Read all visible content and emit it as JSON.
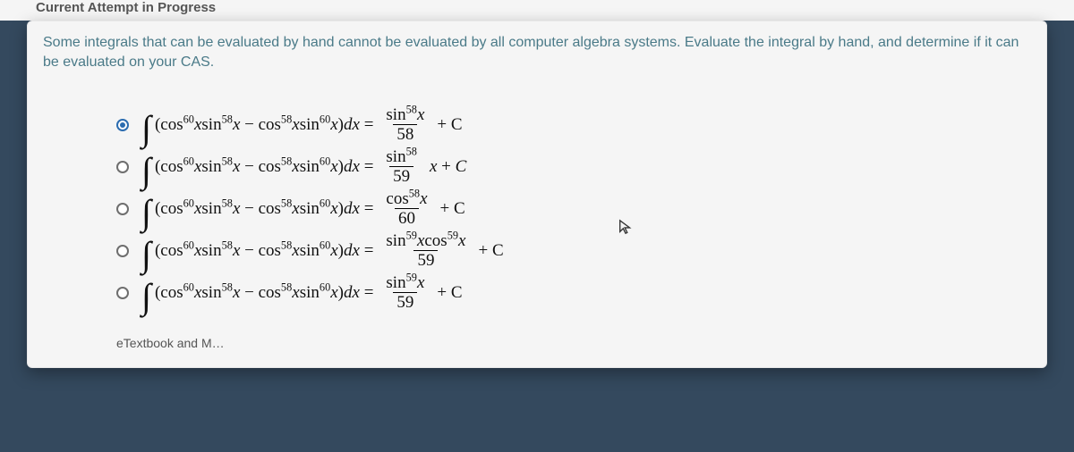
{
  "header": {
    "title": "Current Attempt in Progress"
  },
  "prompt": {
    "text": "Some integrals that can be evaluated by hand cannot be evaluated by all computer algebra systems. Evaluate the integral by hand, and determine if it can be evaluated on your CAS."
  },
  "options": [
    {
      "checked": true,
      "lhs": "∫(cos⁶⁰xsin⁵⁸x − cos⁵⁸xsin⁶⁰x)dx =",
      "rhs_num": "sin⁵⁸x",
      "rhs_den": "58",
      "tail": " + C"
    },
    {
      "checked": false,
      "lhs": "∫(cos⁶⁰xsin⁵⁸x − cos⁵⁸xsin⁶⁰x)dx =",
      "rhs_num": "sin⁵⁸",
      "rhs_den": "59",
      "tail": "x + C"
    },
    {
      "checked": false,
      "lhs": "∫(cos⁶⁰xsin⁵⁸x − cos⁵⁸xsin⁶⁰x)dx =",
      "rhs_num": "cos⁵⁸x",
      "rhs_den": "60",
      "tail": " + C"
    },
    {
      "checked": false,
      "lhs": "∫(cos⁶⁰xsin⁵⁸x − cos⁵⁸xsin⁶⁰x)dx =",
      "rhs_num": "sin⁵⁹xcos⁵⁹x",
      "rhs_den": "59",
      "tail": " + C"
    },
    {
      "checked": false,
      "lhs": "∫(cos⁶⁰xsin⁵⁸x − cos⁵⁸xsin⁶⁰x)dx =",
      "rhs_num": "sin⁵⁹x",
      "rhs_den": "59",
      "tail": " + C"
    }
  ],
  "footer": {
    "etext": "eTextbook and M…"
  },
  "integrand": "(cos<sup>60</sup><i>x</i>sin<sup>58</sup><i>x</i> − cos<sup>58</sup><i>x</i>sin<sup>60</sup><i>x</i>)<i>dx</i> ="
}
